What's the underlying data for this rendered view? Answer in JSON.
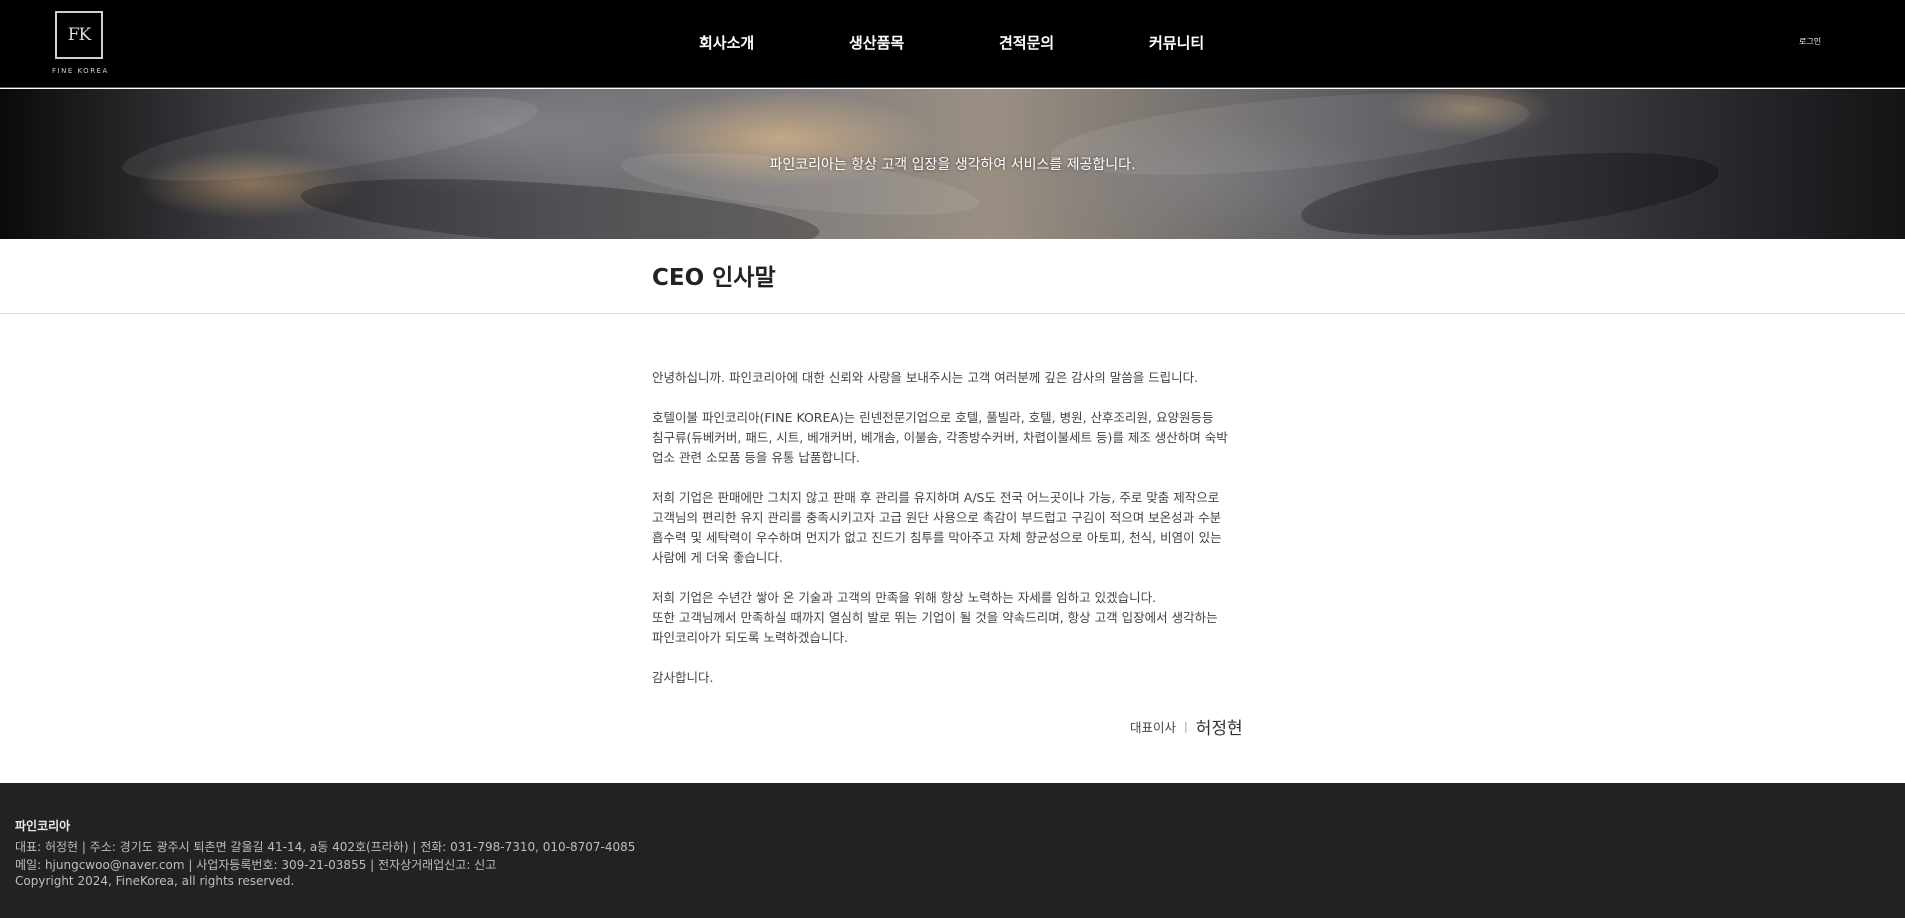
{
  "header": {
    "logo_mark": "FK",
    "logo_name": "FINE KOREA",
    "nav": [
      "회사소개",
      "생산품목",
      "견적문의",
      "커뮤니티"
    ],
    "login": "로그인"
  },
  "hero": {
    "text": "파인코리아는 항상 고객 입장을 생각하여 서비스를 제공합니다."
  },
  "page": {
    "title": "CEO 인사말",
    "paragraphs": [
      [
        "안녕하십니까. 파인코리아에 대한 신뢰와 사랑을 보내주시는 고객 여러분께 깊은 감사의 말씀을 드립니다."
      ],
      [
        "호텔이불 파인코리아(FINE KOREA)는 린넨전문기업으로 호텔, 풀빌라, 호텔, 병원, 산후조리원, 요양원등등",
        "침구류(듀베커버, 패드, 시트, 베개커버, 베개솜, 이불솜, 각종방수커버, 차렵이불세트 등)를 제조 생산하며 숙박",
        "업소 관련 소모품 등을 유통 납품합니다."
      ],
      [
        "저희 기업은 판매에만 그치지 않고 판매 후 관리를 유지하며 A/S도 전국 어느곳이나 가능, 주로 맞춤 제작으로",
        "고객님의 편리한 유지 관리를 충족시키고자 고급 원단 사용으로 촉감이 부드럽고 구김이 적으며 보온성과 수분",
        "흡수력 및 세탁력이 우수하며 먼지가 없고 진드기 침투를 막아주고 자체 향균성으로 아토피, 천식, 비염이 있는",
        "사람에 게 더욱 좋습니다."
      ],
      [
        "저희 기업은 수년간 쌓아 온 기술과 고객의 만족을 위해 항상 노력하는 자세를 임하고 있겠습니다.",
        "또한 고객님께서 만족하실 때까지 열심히 발로 뛰는 기업이 될 것을 약속드리며, 항상 고객 입장에서 생각하는",
        "파인코리아가 되도록 노력하겠습니다."
      ],
      [
        "감사합니다."
      ]
    ],
    "signature": {
      "role": "대표이사",
      "separator": "|",
      "name": "허정현"
    }
  },
  "footer": {
    "company": "파인코리아",
    "line1": "대표: 허정현 | 주소: 경기도 광주시 퇴촌면 갈울길 41-14, a동 402호(프라하) | 전화: 031-798-7310, 010-8707-4085",
    "line2": "메일: hjungcwoo@naver.com | 사업자등록번호: 309-21-03855 | 전자상거래업신고: 신고",
    "copyright": "Copyright 2024, FineKorea, all rights reserved."
  },
  "colors": {
    "header_bg": "#000000",
    "header_border": "#6b5a33",
    "footer_bg": "#222222"
  }
}
